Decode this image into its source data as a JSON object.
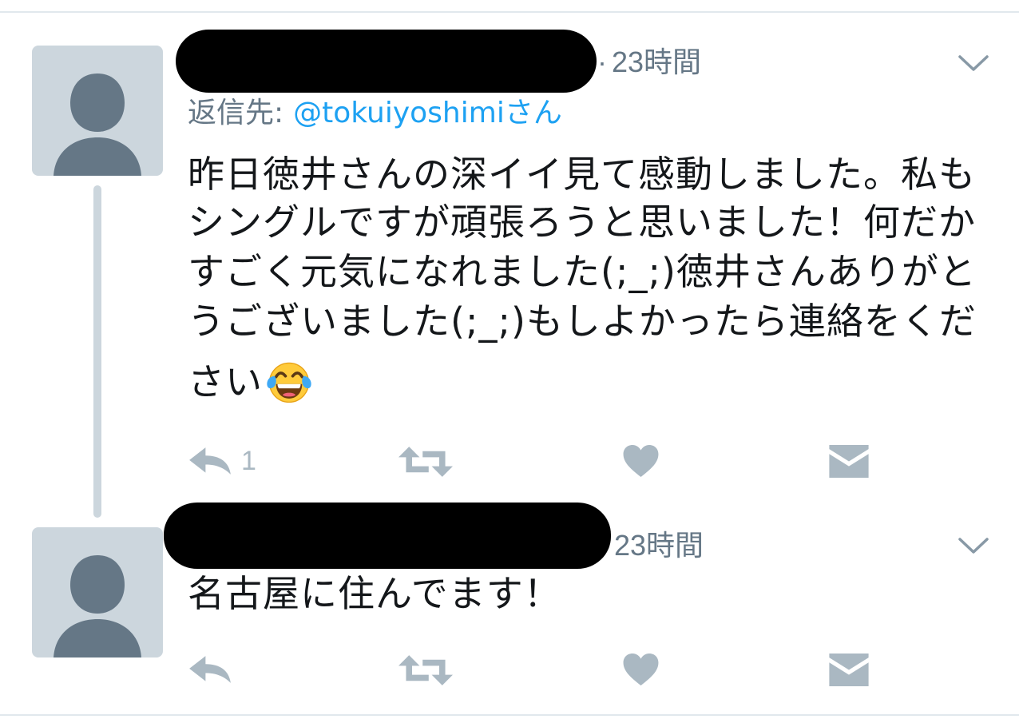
{
  "colors": {
    "text": "#14171a",
    "secondary_text": "#657786",
    "link": "#1da1f2",
    "action_icon": "#aab8c2",
    "chevron": "#8899a6",
    "avatar_background": "#ccd6dd",
    "avatar_silhouette": "#657786",
    "thread_line": "#ccd6dd",
    "divider": "#e1e8ed",
    "redaction": "#000000"
  },
  "tweets": [
    {
      "avatar": "default-profile-avatar",
      "separator": "·",
      "time": "23時間",
      "menu_icon": "chevron-down-icon",
      "reply_to": {
        "label": "返信先:",
        "handle": "@tokuiyoshimiさん"
      },
      "text_lines": [
        "昨日徳井さんの深イイ見て感動しました。私も",
        "シングルですが頑張ろうと思いました！何だか",
        "すごく元気になれました(;_;)徳井さんありがと",
        "うございました(;_;)もしよかったら連絡をくだ",
        "さい"
      ],
      "emoji": "face-with-tears-of-joy-icon",
      "actions": {
        "reply": {
          "icon": "reply-icon",
          "count": "1"
        },
        "retweet": {
          "icon": "retweet-icon"
        },
        "like": {
          "icon": "heart-icon"
        },
        "message": {
          "icon": "envelope-icon"
        }
      }
    },
    {
      "avatar": "default-profile-avatar",
      "time": "23時間",
      "menu_icon": "chevron-down-icon",
      "text_lines": [
        "名古屋に住んでます！"
      ],
      "actions": {
        "reply": {
          "icon": "reply-icon"
        },
        "retweet": {
          "icon": "retweet-icon"
        },
        "like": {
          "icon": "heart-icon"
        },
        "message": {
          "icon": "envelope-icon"
        }
      }
    }
  ]
}
